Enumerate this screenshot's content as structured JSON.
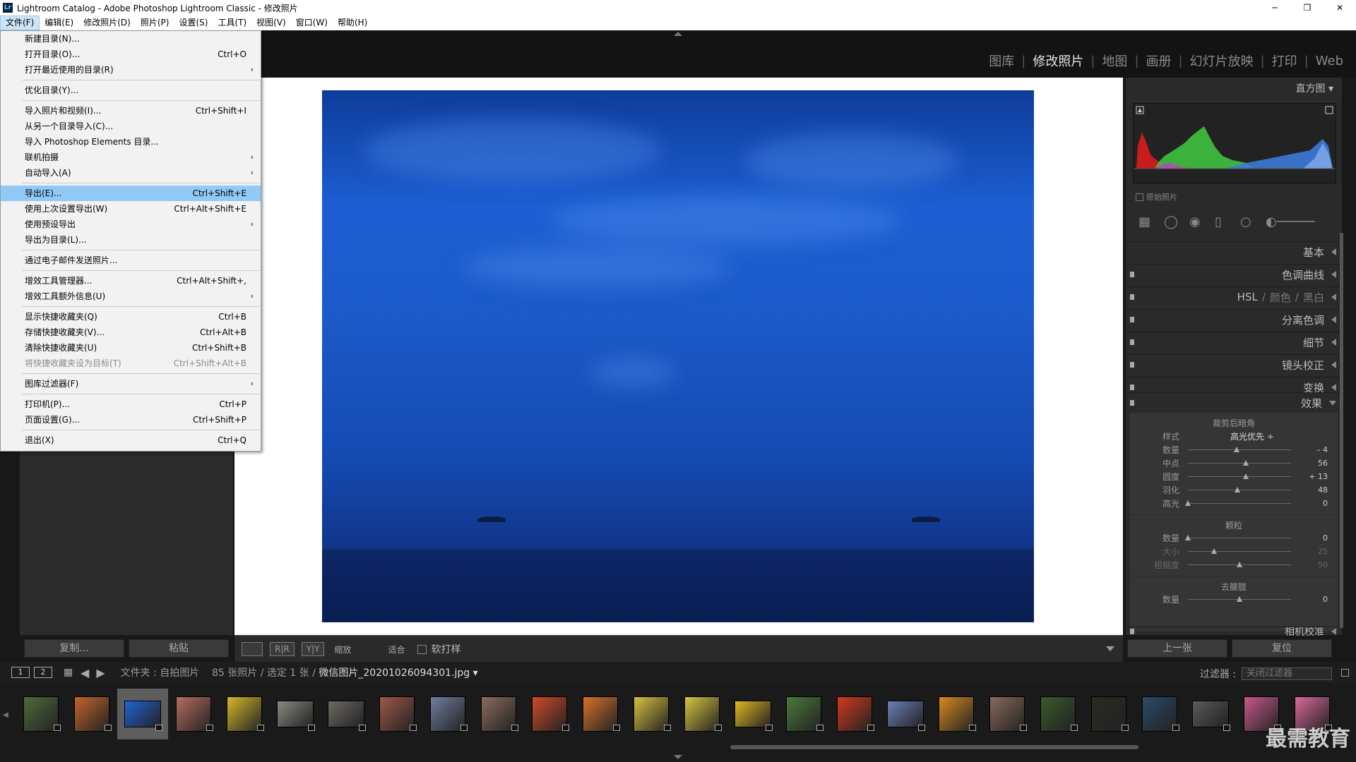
{
  "titlebar": {
    "icon": "Lr",
    "title": "Lightroom Catalog - Adobe Photoshop Lightroom Classic - 修改照片",
    "minimize": "─",
    "maximize": "❐",
    "close": "✕"
  },
  "menubar": [
    "文件(F)",
    "编辑(E)",
    "修改照片(D)",
    "照片(P)",
    "设置(S)",
    "工具(T)",
    "视图(V)",
    "窗口(W)",
    "帮助(H)"
  ],
  "modules": [
    "图库",
    "修改照片",
    "地图",
    "画册",
    "幻灯片放映",
    "打印",
    "Web"
  ],
  "file_menu": [
    {
      "label": "新建目录(N)..."
    },
    {
      "label": "打开目录(O)...",
      "shortcut": "Ctrl+O"
    },
    {
      "label": "打开最近使用的目录(R)",
      "arrow": "›"
    },
    {
      "sep": true
    },
    {
      "label": "优化目录(Y)..."
    },
    {
      "sep": true
    },
    {
      "label": "导入照片和视频(I)...",
      "shortcut": "Ctrl+Shift+I"
    },
    {
      "label": "从另一个目录导入(C)..."
    },
    {
      "label": "导入 Photoshop Elements 目录..."
    },
    {
      "label": "联机拍摄",
      "arrow": "›"
    },
    {
      "label": "自动导入(A)",
      "arrow": "›"
    },
    {
      "sep": true
    },
    {
      "label": "导出(E)...",
      "shortcut": "Ctrl+Shift+E",
      "highlight": true
    },
    {
      "label": "使用上次设置导出(W)",
      "shortcut": "Ctrl+Alt+Shift+E"
    },
    {
      "label": "使用预设导出",
      "arrow": "›"
    },
    {
      "label": "导出为目录(L)..."
    },
    {
      "sep": true
    },
    {
      "label": "通过电子邮件发送照片..."
    },
    {
      "sep": true
    },
    {
      "label": "增效工具管理器...",
      "shortcut": "Ctrl+Alt+Shift+,"
    },
    {
      "label": "增效工具额外信息(U)",
      "arrow": "›"
    },
    {
      "sep": true
    },
    {
      "label": "显示快捷收藏夹(Q)",
      "shortcut": "Ctrl+B"
    },
    {
      "label": "存储快捷收藏夹(V)...",
      "shortcut": "Ctrl+Alt+B"
    },
    {
      "label": "清除快捷收藏夹(U)",
      "shortcut": "Ctrl+Shift+B"
    },
    {
      "label": "将快捷收藏夹设为目标(T)",
      "shortcut": "Ctrl+Shift+Alt+B",
      "disabled": true
    },
    {
      "sep": true
    },
    {
      "label": "图库过滤器(F)",
      "arrow": "›"
    },
    {
      "sep": true
    },
    {
      "label": "打印机(P)...",
      "shortcut": "Ctrl+P"
    },
    {
      "label": "页面设置(G)...",
      "shortcut": "Ctrl+Shift+P"
    },
    {
      "sep": true
    },
    {
      "label": "退出(X)",
      "shortcut": "Ctrl+Q"
    }
  ],
  "left_buttons": {
    "copy": "复制...",
    "paste": "粘贴"
  },
  "toolbar": {
    "compare1": "R|R",
    "compare2": "Y|Y",
    "zoom_label": "缩放",
    "fit_label": "适合",
    "softproof": "软打样"
  },
  "right_panel": {
    "histogram": "直方图",
    "original_photo": "原始照片",
    "sections": [
      "基本",
      "色调曲线",
      "HSL",
      "颜色",
      "黑白",
      "分离色调",
      "细节",
      "镜头校正",
      "变换",
      "效果"
    ],
    "hsl_sep": "/",
    "vignette": {
      "title": "裁剪后暗角",
      "style_label": "样式",
      "style_value": "高光优先 ÷",
      "sliders": [
        {
          "label": "数量",
          "value": "– 4",
          "pos": 0.47
        },
        {
          "label": "中点",
          "value": "56",
          "pos": 0.56
        },
        {
          "label": "圆度",
          "value": "+ 13",
          "pos": 0.56
        },
        {
          "label": "羽化",
          "value": "48",
          "pos": 0.48
        },
        {
          "label": "高光",
          "value": "0",
          "pos": 0.0
        }
      ]
    },
    "grain": {
      "title": "颗粒",
      "sliders": [
        {
          "label": "数量",
          "value": "0",
          "pos": 0.0
        },
        {
          "label": "大小",
          "value": "25",
          "pos": 0.25,
          "dim": true
        },
        {
          "label": "粗糙度",
          "value": "50",
          "pos": 0.5,
          "dim": true
        }
      ]
    },
    "dehaze": {
      "title": "去朦胧",
      "sliders": [
        {
          "label": "数量",
          "value": "0",
          "pos": 0.5
        }
      ]
    },
    "camera_calibration": "相机校准",
    "prev_button": "上一张",
    "reset_button": "复位"
  },
  "filmstrip_header": {
    "view1": "1",
    "view2": "2",
    "path_prefix": "文件夹 : 自拍图片",
    "count": "85 张照片 / 选定 1 张 /",
    "filename": "微信图片_20201026094301.jpg ▾",
    "filter_label": "过滤器 :",
    "filter_value": "关闭过滤器"
  },
  "filmstrip_thumbs": [
    "#4f6b3a",
    "#c2662e",
    "#1f63d8",
    "#b66e5f",
    "#d6b82a",
    "#8a8a80",
    "#6d6a64",
    "#a0584a",
    "#6f7da0",
    "#8c6b5e",
    "#d04a2a",
    "#d6722a",
    "#d8c040",
    "#d8c540",
    "#e0b820",
    "#4a7a3a",
    "#d23a1e",
    "#6a7fb8",
    "#d88a20",
    "#8a6a5a",
    "#3a5a2a",
    "#282c20",
    "#2a4a6a",
    "#5a5a5a",
    "#c85a8a",
    "#d86a9a"
  ],
  "watermark": "最需教育"
}
